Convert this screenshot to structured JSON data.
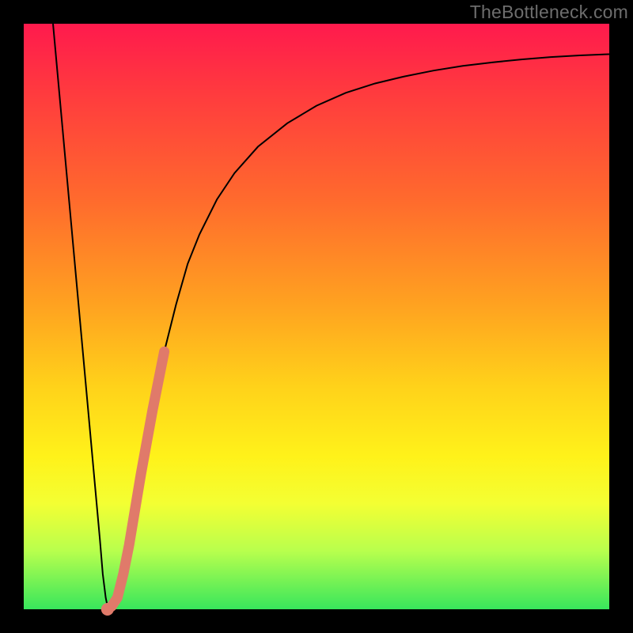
{
  "watermark": "TheBottleneck.com",
  "chart_data": {
    "type": "line",
    "title": "",
    "xlabel": "",
    "ylabel": "",
    "xlim": [
      0,
      100
    ],
    "ylim": [
      0,
      100
    ],
    "series": [
      {
        "name": "black-curve",
        "color": "#000000",
        "stroke_width": 2,
        "x": [
          5,
          6,
          7,
          8,
          9,
          10,
          11,
          12,
          13,
          13.5,
          14,
          14.3,
          14.5,
          15,
          15.5,
          16,
          17,
          18,
          19,
          20,
          22,
          24,
          26,
          28,
          30,
          33,
          36,
          40,
          45,
          50,
          55,
          60,
          65,
          70,
          75,
          80,
          85,
          90,
          95,
          100
        ],
        "y": [
          100,
          89,
          78,
          67,
          56,
          45,
          34,
          23,
          12,
          6,
          2,
          0.5,
          0,
          0.3,
          0.8,
          2,
          6,
          11,
          17,
          23,
          34,
          44,
          52,
          59,
          64,
          70,
          74.5,
          79,
          83,
          86,
          88.2,
          89.8,
          91,
          92,
          92.8,
          93.4,
          93.9,
          94.3,
          94.6,
          94.8
        ]
      },
      {
        "name": "salmon-overlay",
        "color": "#e07a6a",
        "stroke_width": 13,
        "linecap": "round",
        "x": [
          14.3,
          15,
          16,
          17,
          18,
          19,
          20,
          21,
          22,
          23,
          24
        ],
        "y": [
          0,
          0.5,
          2,
          6,
          11,
          17,
          23,
          28.5,
          34,
          39,
          44
        ]
      }
    ],
    "minimum_marker": {
      "x": 14.3,
      "y": 0,
      "color": "#e07a6a",
      "radius": 8
    }
  }
}
